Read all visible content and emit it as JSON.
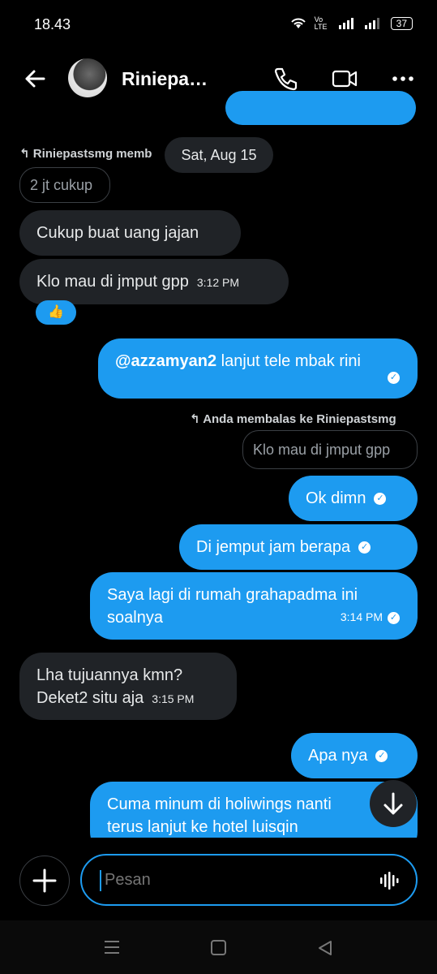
{
  "status": {
    "time": "18.43",
    "battery": "37",
    "net": "Vo LTE"
  },
  "header": {
    "title": "Riniepa…"
  },
  "date_chip": "Sat, Aug 15",
  "messages": {
    "reply1_label": "Riniepastsmg memb",
    "reply1_quote": "2 jt cukup",
    "m1": "Cukup buat uang jajan",
    "m2": "Klo mau di jmput gpp",
    "m2_time": "3:12 PM",
    "reaction": "👍",
    "m3_mention": "@azzamyan2",
    "m3_text": " lanjut tele mbak rini",
    "reply2_label": "Anda membalas ke Riniepastsmg",
    "reply2_quote": "Klo mau di jmput gpp",
    "m4": "Ok dimn",
    "m5": "Di jemput jam berapa",
    "m6_line1": "Saya lagi di rumah grahapadma ini",
    "m6_line2": "soalnya",
    "m6_time": "3:14 PM",
    "m7_line1": "Lha tujuannya kmn?",
    "m7_line2": "Deket2 situ aja",
    "m7_time": "3:15 PM",
    "m8": "Apa nya",
    "m9_line1": "Cuma minum di holiwings nanti",
    "m9_line2": "terus lanjut ke hotel luisqin"
  },
  "composer": {
    "placeholder": "Pesan"
  },
  "colors": {
    "accent": "#1d9bf0",
    "incoming": "#202327",
    "background": "#000000"
  }
}
